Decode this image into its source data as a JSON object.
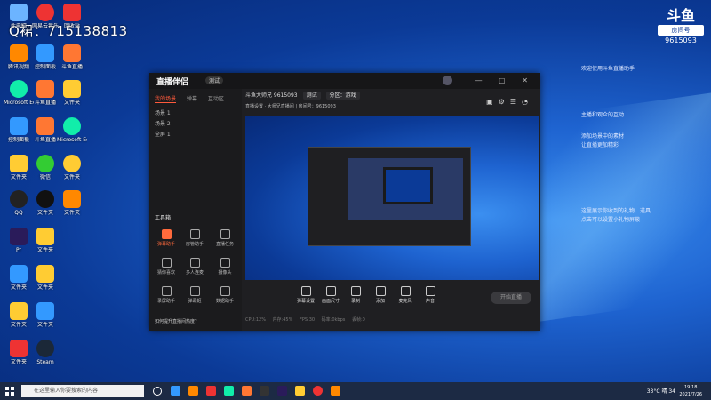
{
  "desktop": {
    "qq_text": "Q裙：715138813",
    "icons": [
      {
        "label": "此电脑",
        "color": "#6cb4ff"
      },
      {
        "label": "网易云音乐",
        "color": "#e33"
      },
      {
        "label": "回收站",
        "color": "#9bd"
      },
      {
        "label": "腾讯视频",
        "color": "#f80"
      },
      {
        "label": "控制面板",
        "color": "#39f"
      },
      {
        "label": "斗鱼直播",
        "color": "#f73"
      },
      {
        "label": "Microsoft Edge",
        "color": "#1ea"
      },
      {
        "label": "QQ",
        "color": "#222"
      },
      {
        "label": "微信",
        "color": "#3c3"
      },
      {
        "label": "Pr",
        "color": "#2a1b5a"
      },
      {
        "label": "Steam",
        "color": "#1b2838"
      },
      {
        "label": "文件夹",
        "color": "#fc3"
      }
    ]
  },
  "overlay": {
    "brand": "斗鱼",
    "tag": "房间号",
    "room_number": "9615093",
    "lines": [
      "欢迎使用斗鱼直播助手",
      "主播和观众的互动",
      "添加场景中的素材",
      "让直播更加精彩",
      "这里展示你收到的礼物、道具",
      "点击可以设置小礼物屏蔽"
    ]
  },
  "app": {
    "logo": "直播伴侣",
    "version": "测试",
    "window_controls": "—  ▢  ✕",
    "tabs": [
      "我的场景",
      "弹幕",
      "互动区"
    ],
    "scenes": [
      "场景 1",
      "场景 2",
      "全屏 1"
    ],
    "tool_title": "工具箱",
    "tools": [
      "弹幕助手",
      "房管助手",
      "直播任务",
      "猜你喜欢",
      "多人连麦",
      "摄像头",
      "录屏助手",
      "弹幕姬",
      "数据助手"
    ],
    "bottom_note": "如何提升直播间热度？",
    "room_info": "斗鱼大师兄 9615093",
    "chip1": "测试",
    "chip2": "分区：游戏",
    "info_line": "直播设置 · 大师兄直播间  |  房间号：9615093",
    "controls": [
      "弹幕设置",
      "画面尺寸",
      "录制",
      "添加",
      "麦克风",
      "声音"
    ],
    "start_btn": "开始直播",
    "status": "CPU:12%  内存:45%  FPS:30  码率:0kbps  丢帧:0"
  },
  "taskbar": {
    "search_placeholder": "在这里输入你要搜索的内容",
    "weather": "33°C 晴 34",
    "time": "19:18",
    "date": "2021/7/26",
    "task_icons": [
      "#39f",
      "#f80",
      "#e33",
      "#1ea",
      "#2a1b5a",
      "#fc3",
      "#f73"
    ]
  }
}
